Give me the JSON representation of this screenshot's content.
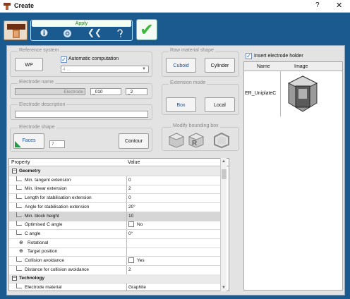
{
  "window": {
    "title": "Create",
    "help": "?",
    "close": "✕"
  },
  "toolbar": {
    "apply_label": "Apply"
  },
  "reference_system": {
    "label": "Reference system",
    "wp_button": "WP",
    "auto_label": "Automatic computation",
    "auto_checked": true,
    "dropdown_value": "4 ..."
  },
  "electrode_name": {
    "label": "Electrode name",
    "prefix": "Electrode",
    "number": "_010",
    "suffix": "_2"
  },
  "electrode_description": {
    "label": "Electrode description",
    "value": ""
  },
  "electrode_shape": {
    "label": "Electrode shape",
    "faces_button": "Faces",
    "count": "7",
    "contour_button": "Contour"
  },
  "raw_material": {
    "label": "Raw material shape",
    "cuboid_button": "Cuboid",
    "cylinder_button": "Cylinder"
  },
  "extension_mode": {
    "label": "Extension mode",
    "box_button": "Box",
    "local_button": "Local"
  },
  "modify_bbox": {
    "label": "Modify bounding box"
  },
  "holder": {
    "insert_label": "Insert electrode holder",
    "insert_checked": true,
    "col_name": "Name",
    "col_image": "Image",
    "row_name": "ER_UniplateC"
  },
  "grid": {
    "col_property": "Property",
    "col_value": "Value",
    "rows": [
      {
        "type": "cat",
        "label": "Geometry",
        "value": ""
      },
      {
        "type": "item",
        "label": "Min. tangent extension",
        "value": "0"
      },
      {
        "type": "item",
        "label": "Min. linear extension",
        "value": "2"
      },
      {
        "type": "item",
        "label": "Length for stabilisation extension",
        "value": "0"
      },
      {
        "type": "item",
        "label": "Angle for stabilisation extension",
        "value": "20°"
      },
      {
        "type": "sel",
        "label": "Min. block height",
        "value": "10"
      },
      {
        "type": "item",
        "label": "Optimised C angle",
        "value": "No"
      },
      {
        "type": "item",
        "label": "C angle",
        "value": "0°"
      },
      {
        "type": "sub",
        "label": "Rotational",
        "value": ""
      },
      {
        "type": "sub",
        "label": "Target position",
        "value": ""
      },
      {
        "type": "item",
        "label": "Collision avoidance",
        "value": "Yes"
      },
      {
        "type": "item",
        "label": "Distance for collision avoidance",
        "value": "2"
      },
      {
        "type": "cat",
        "label": "Technology",
        "value": ""
      },
      {
        "type": "item",
        "label": "Electrode material",
        "value": "Graphite"
      }
    ]
  },
  "colors": {
    "frame": "#1a5a8e",
    "accent": "#1b5faa",
    "ok_green": "#3eb83e"
  }
}
